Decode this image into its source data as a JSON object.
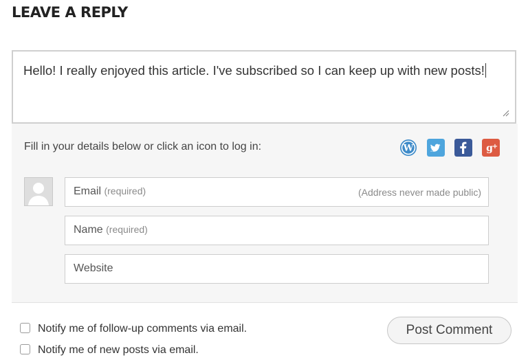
{
  "heading": "LEAVE A REPLY",
  "comment": {
    "text": "Hello! I really enjoyed this article. I've subscribed so I can keep up with new posts!"
  },
  "login": {
    "prompt": "Fill in your details below or click an icon to log in:",
    "services": [
      {
        "name": "wordpress-icon",
        "color": "#3e8bc9"
      },
      {
        "name": "twitter-icon",
        "color": "#4ea5dd"
      },
      {
        "name": "facebook-icon",
        "color": "#3b5a99"
      },
      {
        "name": "google-plus-icon",
        "color": "#dd5b42"
      }
    ]
  },
  "fields": {
    "email": {
      "label": "Email",
      "required": "(required)",
      "hint": "(Address never made public)"
    },
    "name": {
      "label": "Name",
      "required": "(required)"
    },
    "website": {
      "label": "Website"
    }
  },
  "options": {
    "notify_comments": "Notify me of follow-up comments via email.",
    "notify_posts": "Notify me of new posts via email."
  },
  "submit_label": "Post Comment"
}
